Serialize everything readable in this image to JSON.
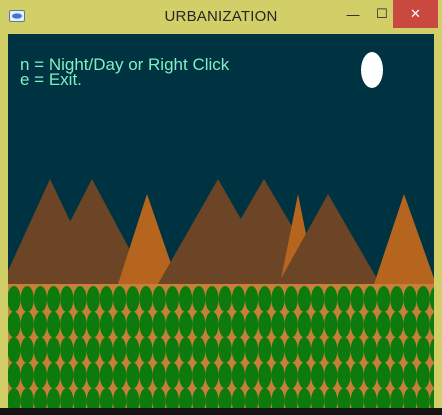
{
  "window": {
    "title": "URBANIZATION",
    "controls": {
      "minimize": "—",
      "maximize": "☐",
      "close": "✕"
    }
  },
  "instructions": {
    "line1": "n = Night/Day or Right Click",
    "line2": "e = Exit."
  },
  "scene": {
    "mode": "night",
    "sky_color": "#003341",
    "moon_color": "#ffffff",
    "mountain_colors": {
      "dark": "#6b4526",
      "light": "#b5651d"
    },
    "ground_color": "#c87f3a",
    "tree_color": "#0d7a0d",
    "tree_rows": 5
  }
}
